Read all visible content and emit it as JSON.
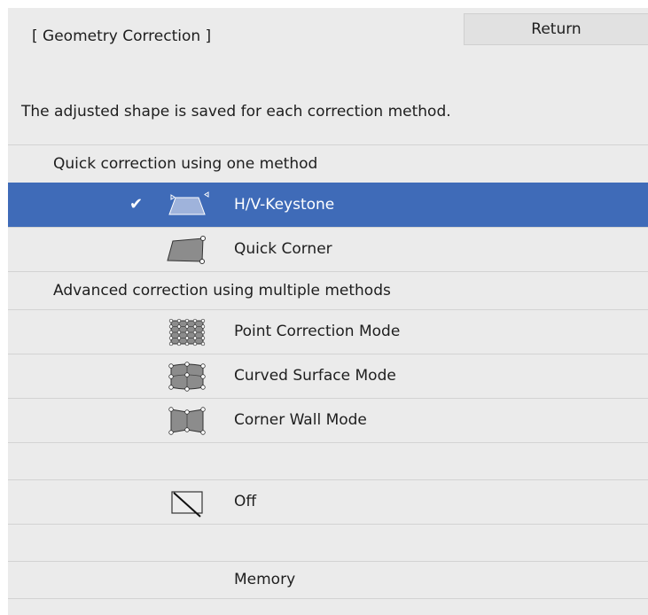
{
  "header": {
    "title": "[ Geometry Correction ]",
    "return_label": "Return"
  },
  "description": "The adjusted shape is saved for each correction method.",
  "sections": {
    "quick": "Quick correction using one method",
    "advanced": "Advanced correction using multiple methods"
  },
  "items": {
    "hv_keystone": "H/V-Keystone",
    "quick_corner": "Quick Corner",
    "point_correction": "Point Correction Mode",
    "curved_surface": "Curved Surface Mode",
    "corner_wall": "Corner Wall Mode",
    "off": "Off",
    "memory": "Memory"
  },
  "selected_item": "hv_keystone",
  "icons": {
    "check": "checkmark-icon",
    "hv_keystone": "keystone-icon",
    "quick_corner": "quick-corner-icon",
    "point_correction": "point-grid-icon",
    "curved_surface": "curved-surface-icon",
    "corner_wall": "corner-wall-icon",
    "off": "off-slash-icon"
  },
  "colors": {
    "background": "#ebebeb",
    "selected": "#3f6bb8",
    "button": "#e1e1e1",
    "divider": "#d3d3d3",
    "icon_fill": "#8c8c8c"
  }
}
